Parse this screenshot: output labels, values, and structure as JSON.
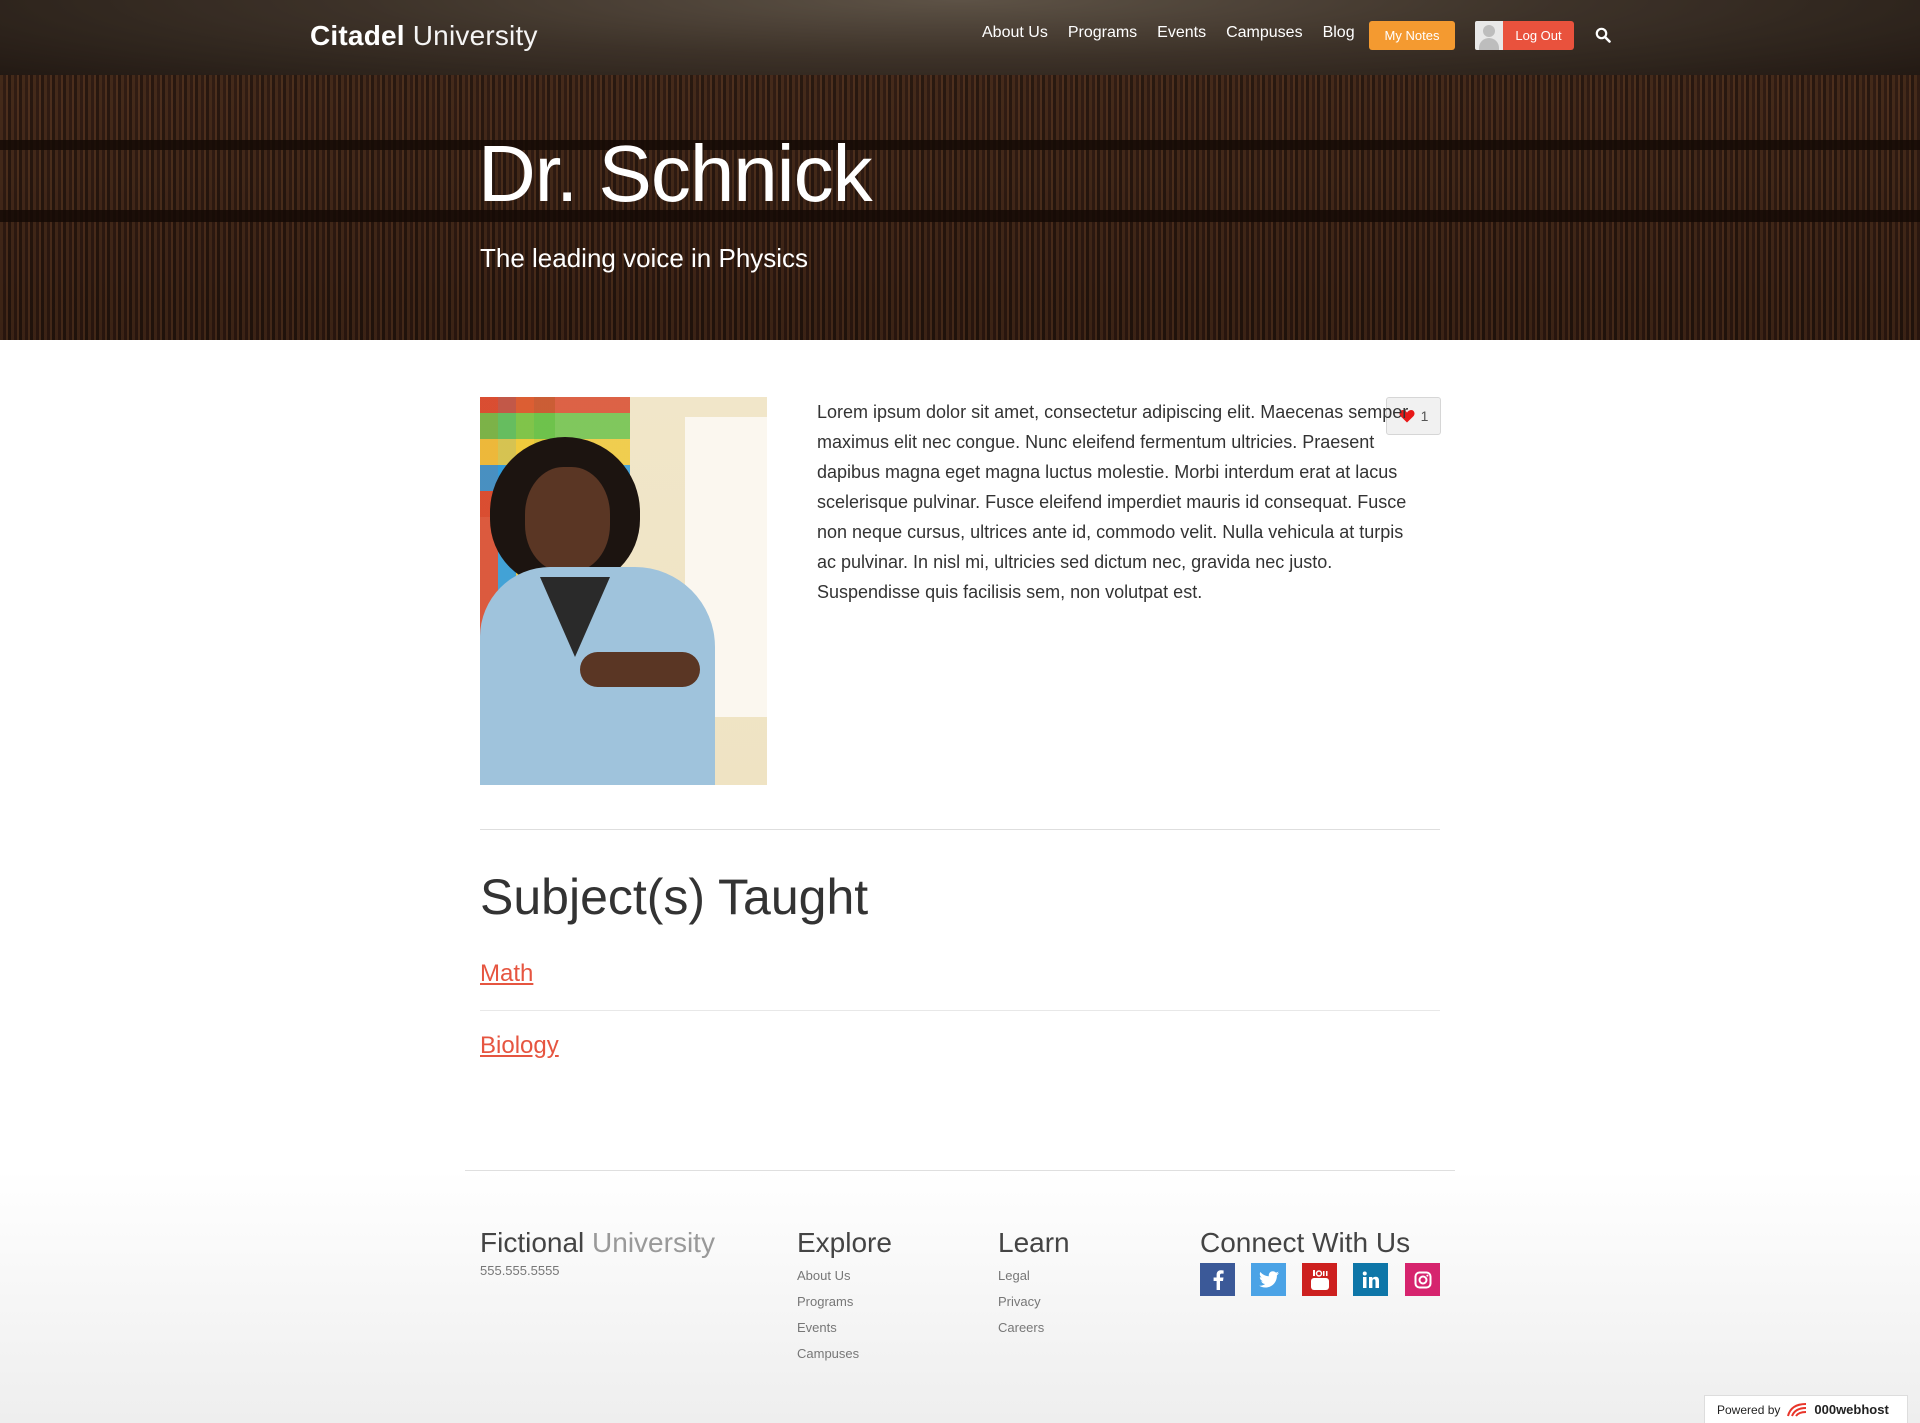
{
  "header": {
    "brand_bold": "Citadel",
    "brand_light": "University",
    "nav": [
      "About Us",
      "Programs",
      "Events",
      "Campuses",
      "Blog"
    ],
    "my_notes": "My Notes",
    "log_out": "Log Out"
  },
  "hero": {
    "title": "Dr. Schnick",
    "subtitle": "The leading voice in Physics"
  },
  "professor": {
    "bio": "Lorem ipsum dolor sit amet, consectetur adipiscing elit. Maecenas semper maximus elit nec congue. Nunc eleifend fermentum ultricies. Praesent dapibus magna eget magna luctus molestie. Morbi interdum erat at lacus scelerisque pulvinar. Fusce eleifend imperdiet mauris id consequat. Fusce non neque cursus, ultrices ante id, commodo velit. Nulla vehicula at turpis ac pulvinar. In nisl mi, ultricies sed dictum nec, gravida nec justo. Suspendisse quis facilisis sem, non volutpat est.",
    "like_count": "1"
  },
  "subjects": {
    "title": "Subject(s) Taught",
    "items": [
      "Math",
      "Biology"
    ]
  },
  "footer": {
    "brand_bold": "Fictional",
    "brand_light": "University",
    "phone": "555.555.5555",
    "explore": {
      "title": "Explore",
      "links": [
        "About Us",
        "Programs",
        "Events",
        "Campuses"
      ]
    },
    "learn": {
      "title": "Learn",
      "links": [
        "Legal",
        "Privacy",
        "Careers"
      ]
    },
    "connect": {
      "title": "Connect With Us",
      "icons": [
        "facebook-icon",
        "twitter-icon",
        "youtube-icon",
        "linkedin-icon",
        "instagram-icon"
      ]
    },
    "powered_by": "Powered by",
    "host_name": "000webhost"
  },
  "colors": {
    "accent": "#e65540",
    "notes_button": "#f49a30",
    "logout_button": "#e9523d",
    "facebook": "#3b5998",
    "twitter": "#4ba3e6",
    "youtube": "#cd201f",
    "linkedin": "#0e76a8",
    "instagram": "#d6246e"
  }
}
